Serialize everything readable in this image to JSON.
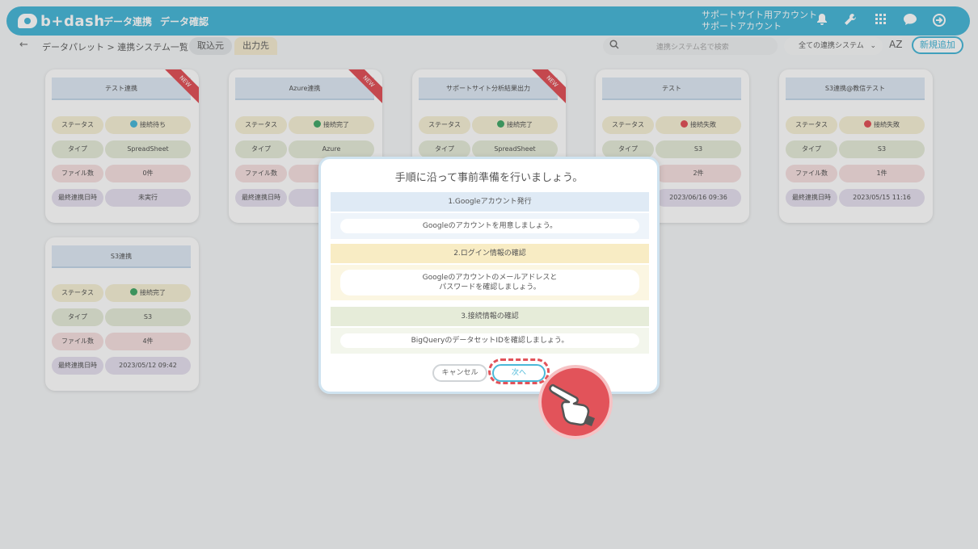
{
  "app": {
    "logo_text": "b+dash"
  },
  "nav": {
    "items": [
      "データ連携",
      "データ確認"
    ]
  },
  "account": {
    "line1": "サポートサイト用アカウント",
    "line2": "サポートアカウント"
  },
  "subbar": {
    "breadcrumb": "データパレット > 連携システム一覧",
    "tab_in": "取込元",
    "tab_out": "出力先",
    "search_placeholder": "連携システム名で検索",
    "filter_value": "全ての連携システム",
    "sort_label": "AZ",
    "new_button": "新規追加"
  },
  "card_labels": {
    "status": "ステータス",
    "type": "タイプ",
    "files": "ファイル数",
    "last": "最終連携日時"
  },
  "new_badge": "NEW",
  "cards": [
    {
      "title": "テスト連携",
      "status": "接続待ち",
      "status_kind": "wait",
      "type": "SpreadSheet",
      "files": "0件",
      "last": "未実行",
      "is_new": true
    },
    {
      "title": "Azure連携",
      "status": "接続完了",
      "status_kind": "ok",
      "type": "Azure",
      "files": "",
      "last": "2023",
      "is_new": true
    },
    {
      "title": "サポートサイト分析結果出力",
      "status": "接続完了",
      "status_kind": "ok",
      "type": "SpreadSheet",
      "files": "",
      "last": "",
      "is_new": true
    },
    {
      "title": "テスト",
      "status": "接続失敗",
      "status_kind": "fail",
      "type": "S3",
      "files": "2件",
      "last": "2023/06/16 09:36",
      "is_new": false
    },
    {
      "title": "S3連携@教信テスト",
      "status": "接続失敗",
      "status_kind": "fail",
      "type": "S3",
      "files": "1件",
      "last": "2023/05/15 11:16",
      "is_new": false
    },
    {
      "title": "S3連携",
      "status": "接続完了",
      "status_kind": "ok",
      "type": "S3",
      "files": "4件",
      "last": "2023/05/12 09:42",
      "is_new": false
    }
  ],
  "modal": {
    "title": "手順に沿って事前準備を行いましょう。",
    "steps": [
      {
        "heading": "1.Googleアカウント発行",
        "body": [
          "Googleのアカウントを用意しましょう。"
        ]
      },
      {
        "heading": "2.ログイン情報の確認",
        "body": [
          "Googleのアカウントのメールアドレスと",
          "パスワードを確認しましょう。"
        ]
      },
      {
        "heading": "3.接続情報の確認",
        "body": [
          "BigQueryのデータセットIDを確認しましょう。"
        ]
      }
    ],
    "cancel": "キャンセル",
    "next": "次へ"
  },
  "colors": {
    "accent": "#4ab8d8",
    "alert": "#e2535a",
    "ok": "#46a96b"
  },
  "icons": [
    "bell-icon",
    "wrench-icon",
    "grid-icon",
    "chat-icon",
    "logout-icon",
    "search-icon",
    "chevron-down-icon",
    "back-arrow-icon",
    "pointing-hand-icon"
  ]
}
